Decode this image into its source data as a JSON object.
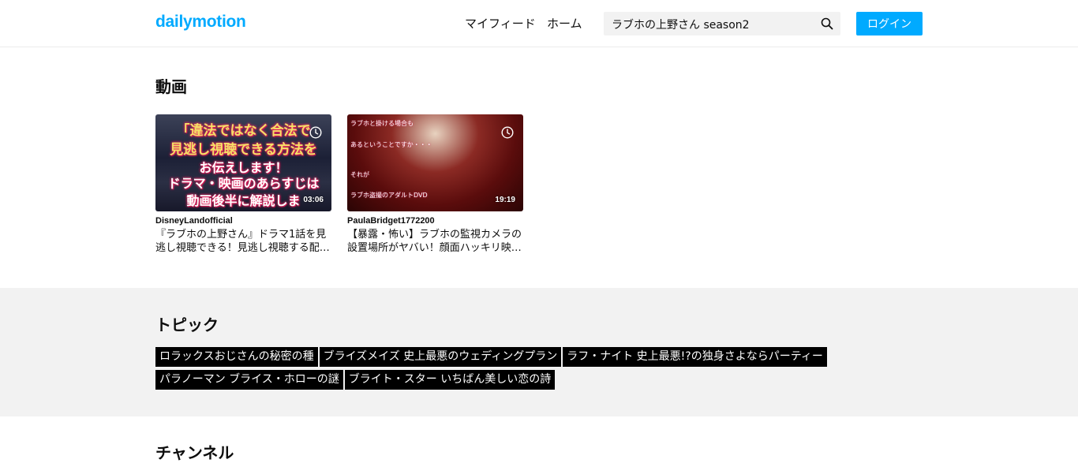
{
  "header": {
    "logo": "dailymotion",
    "nav": {
      "feed": "マイフィード",
      "home": "ホーム"
    },
    "search": {
      "value": "ラブホの上野さん season2",
      "icon": "search-icon"
    },
    "login": "ログイン"
  },
  "videos": {
    "title": "動画",
    "items": [
      {
        "channel": "DisneyLandofficial",
        "title": "『ラブホの上野さん』ドラマ1話を見逃し視聴できる！見逃し視聴する配…",
        "duration": "03:06",
        "thumb_text": [
          "「違法ではなく合法で",
          "見逃し視聴できる方法を",
          "お伝えします！",
          "ドラマ・映画のあらすじは",
          "動画後半に解説しま"
        ]
      },
      {
        "channel": "PaulaBridget1772200",
        "title": "【暴露・怖い】ラブホの監視カメラの設置場所がヤバい！顔面ハッキリ映…",
        "duration": "19:19",
        "thumb_text": [
          "ラブホと掛ける場合も",
          "あるということですか・・・",
          "それが",
          "ラブホ盗撮のアダルトDVD"
        ]
      }
    ]
  },
  "topics": {
    "title": "トピック",
    "chips": [
      "ロラックスおじさんの秘密の種",
      "ブライズメイズ 史上最悪のウェディングプラン",
      "ラフ・ナイト 史上最悪!?の独身さよならパーティー",
      "パラノーマン ブライス・ホローの謎",
      "ブライト・スター いちばん美しい恋の詩"
    ]
  },
  "channels": {
    "title": "チャンネル"
  },
  "colors": {
    "brand": "#00aaff",
    "band": "#f2f2f2",
    "chip": "#000000"
  }
}
